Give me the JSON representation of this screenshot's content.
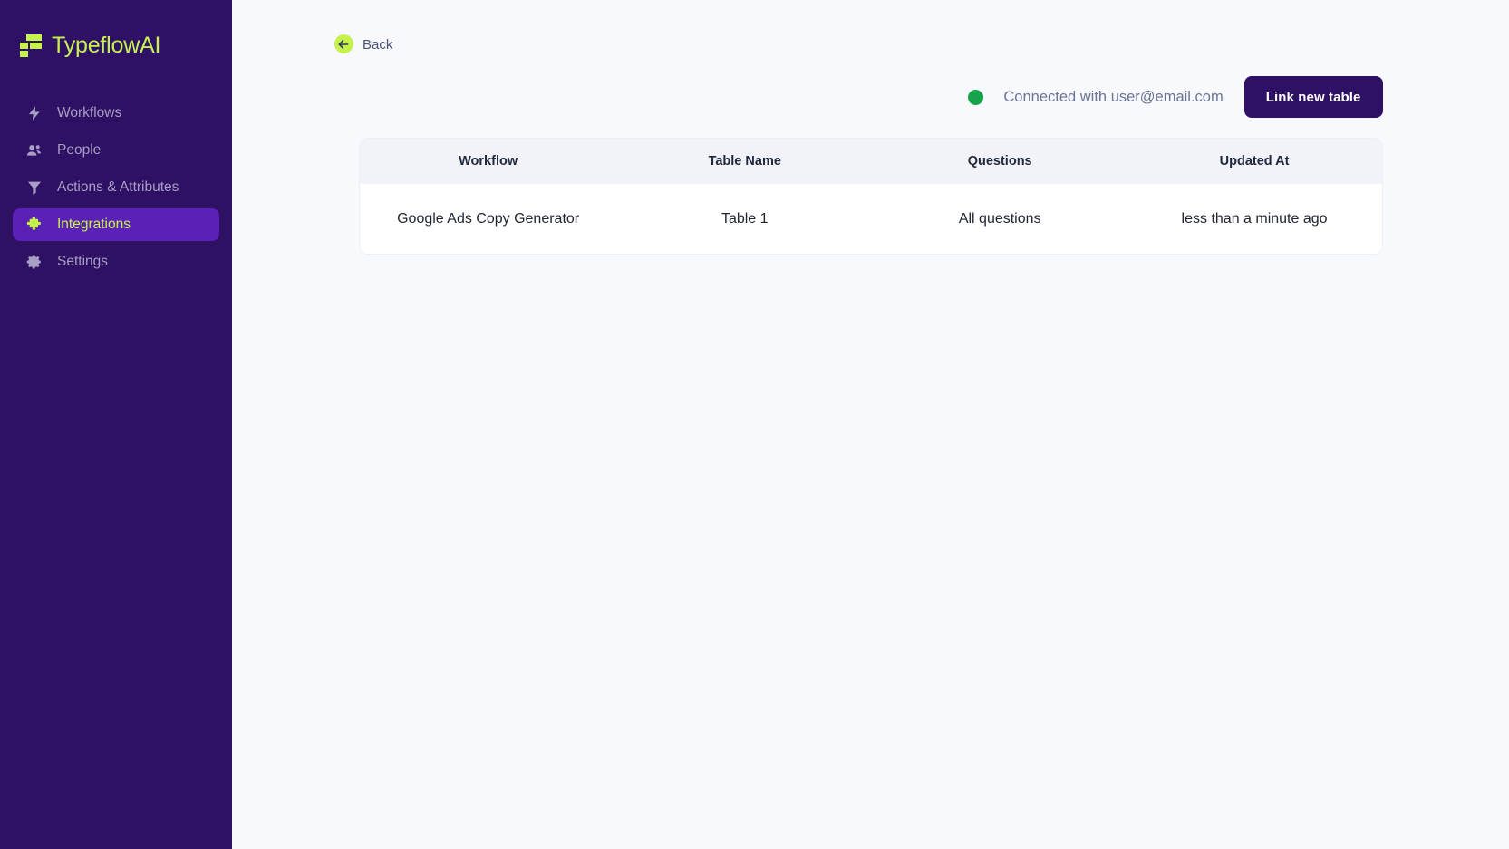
{
  "sidebar": {
    "brand": {
      "name": "TypeflowAI",
      "icon": "typeflow-logo-mark",
      "color": "#c6f24e"
    },
    "items": [
      {
        "label": "Workflows",
        "icon": "lightning-bolt-icon",
        "active": false
      },
      {
        "label": "People",
        "icon": "people-icon",
        "active": false
      },
      {
        "label": "Actions & Attributes",
        "icon": "funnel-filter-icon",
        "active": false
      },
      {
        "label": "Integrations",
        "icon": "puzzle-piece-icon",
        "active": true
      },
      {
        "label": "Settings",
        "icon": "gear-icon",
        "active": false
      }
    ]
  },
  "header": {
    "back_label": "Back",
    "back_icon": "arrow-left-icon"
  },
  "connection": {
    "status_text": "Connected with user@email.com",
    "status_color": "#16a34a",
    "link_button_label": "Link new table",
    "link_button_color": "#2e1065"
  },
  "table": {
    "columns": [
      "Workflow",
      "Table Name",
      "Questions",
      "Updated At"
    ],
    "rows": [
      {
        "workflow": "Google Ads Copy Generator",
        "table_name": "Table 1",
        "questions": "All questions",
        "updated_at": "less than a minute ago"
      }
    ]
  }
}
